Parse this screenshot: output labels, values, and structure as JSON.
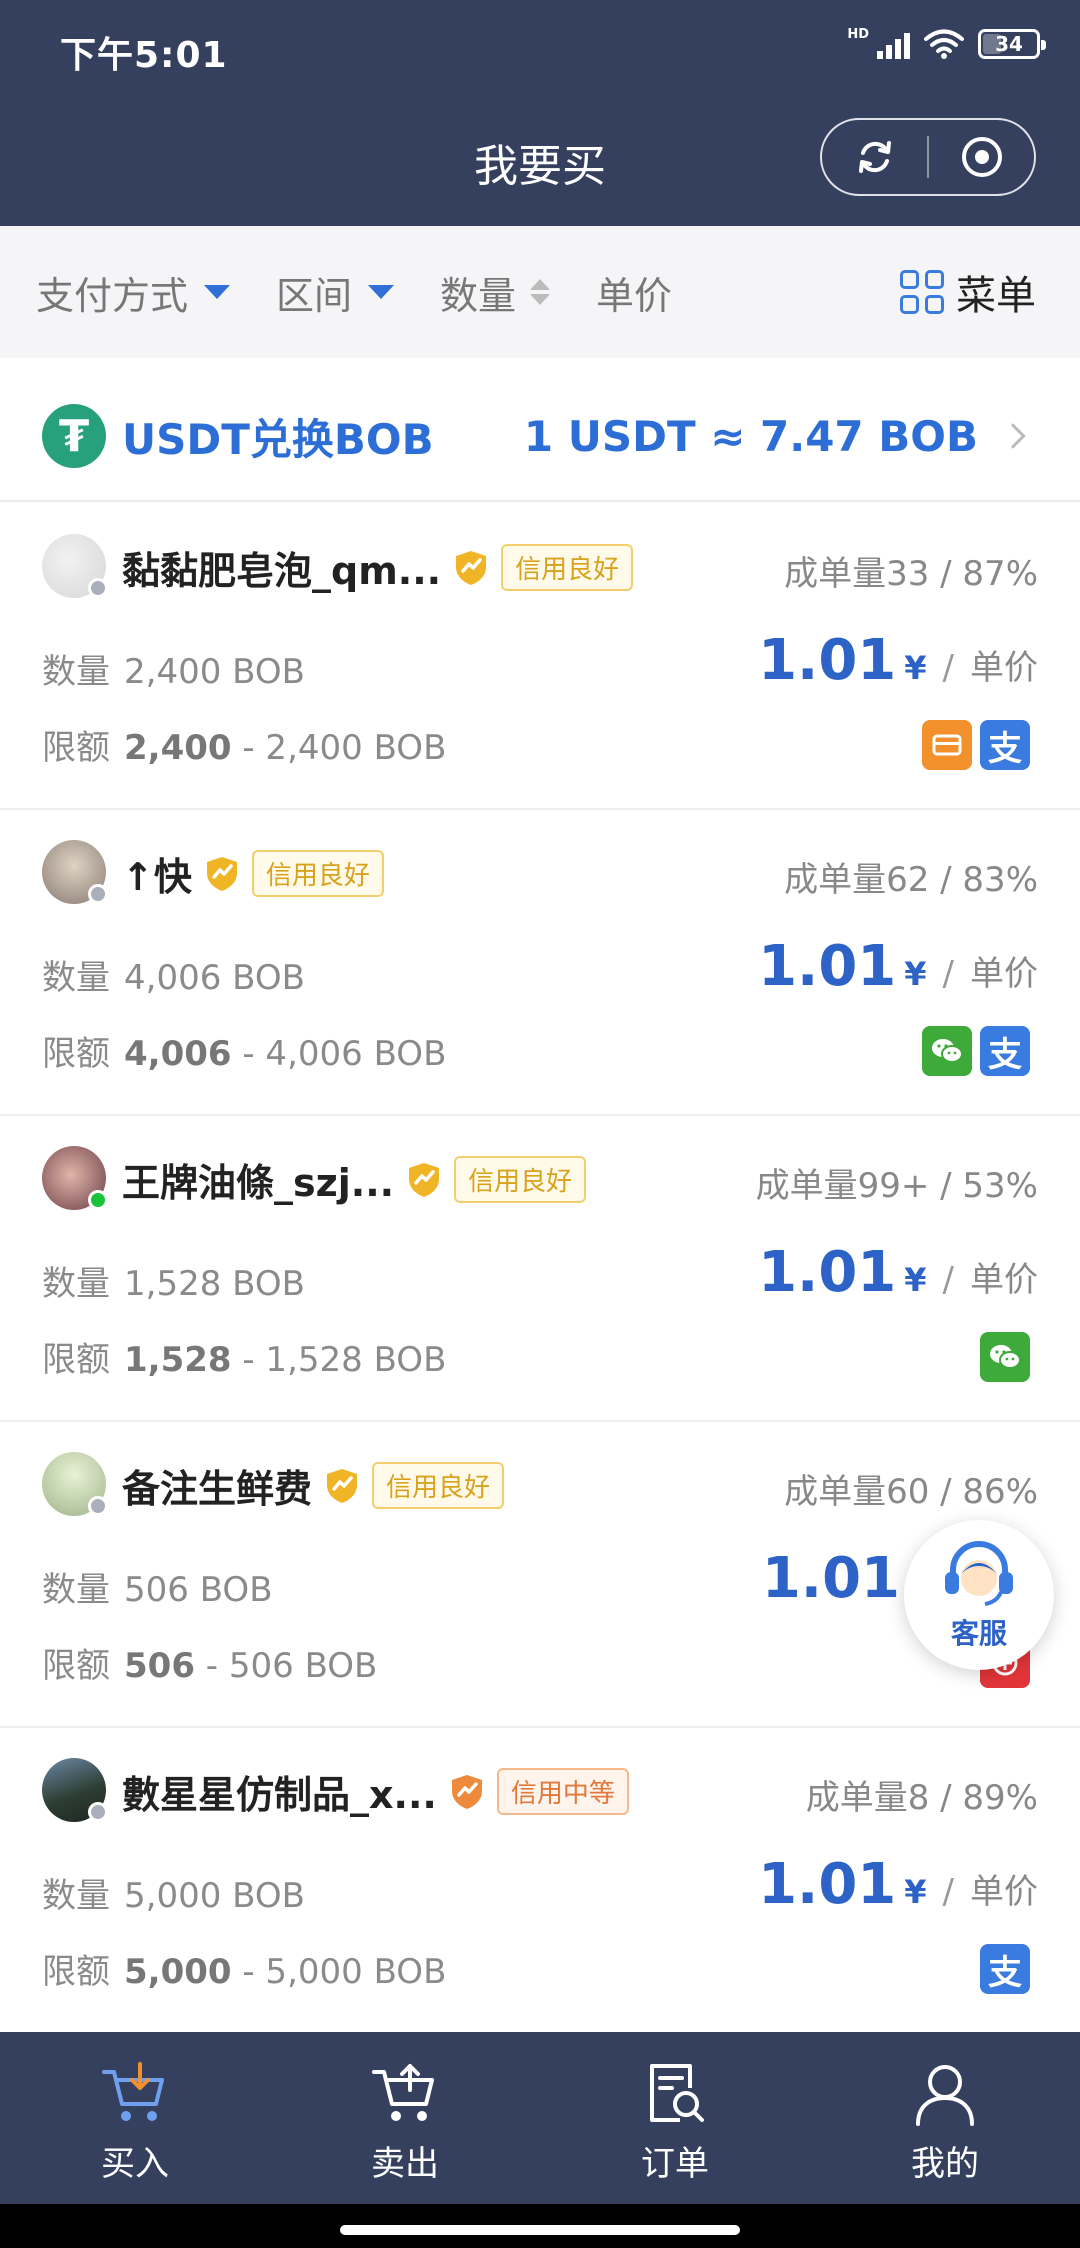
{
  "status_bar": {
    "time": "下午5:01",
    "network": "HD",
    "battery": "34"
  },
  "header": {
    "title": "我要买"
  },
  "filters": {
    "payment": "支付方式",
    "range": "区间",
    "quantity": "数量",
    "price": "单价",
    "menu": "菜单"
  },
  "exchange": {
    "title": "USDT兑换BOB",
    "rate": "1 USDT ≈ 7.47 BOB"
  },
  "listings": [
    {
      "name": "黏黏肥皂泡_qm...",
      "credit": "信用良好",
      "stats": "成单量33 / 87%",
      "qty_label": "数量",
      "qty": "2,400  BOB",
      "limit_label": "限额",
      "limit_min": "2,400",
      "limit_rest": " - 2,400  BOB",
      "price": "1.01",
      "currency": "¥",
      "unit": "单价",
      "payments": [
        "bank-card",
        "alipay"
      ]
    },
    {
      "name": "↑快",
      "credit": "信用良好",
      "stats": "成单量62 / 83%",
      "qty_label": "数量",
      "qty": "4,006  BOB",
      "limit_label": "限额",
      "limit_min": "4,006",
      "limit_rest": " - 4,006  BOB",
      "price": "1.01",
      "currency": "¥",
      "unit": "单价",
      "payments": [
        "wechat",
        "alipay"
      ]
    },
    {
      "name": "王牌油條_szj...",
      "credit": "信用良好",
      "stats": "成单量99+ / 53%",
      "qty_label": "数量",
      "qty": "1,528  BOB",
      "limit_label": "限额",
      "limit_min": "1,528",
      "limit_rest": " - 1,528  BOB",
      "price": "1.01",
      "currency": "¥",
      "unit": "单价",
      "payments": [
        "wechat"
      ]
    },
    {
      "name": "备注生鲜费",
      "credit": "信用良好",
      "stats": "成单量60 / 86%",
      "qty_label": "数量",
      "qty": "506  BOB",
      "limit_label": "限额",
      "limit_min": "506",
      "limit_rest": " - 506  BOB",
      "price": "1.01",
      "currency": "",
      "unit": "",
      "payments": [
        "unionpay"
      ]
    },
    {
      "name": "數星星仿制品_x...",
      "credit": "信用中等",
      "stats": "成单量8 / 89%",
      "qty_label": "数量",
      "qty": "5,000  BOB",
      "limit_label": "限额",
      "limit_min": "5,000",
      "limit_rest": " - 5,000  BOB",
      "price": "1.01",
      "currency": "¥",
      "unit": "单价",
      "payments": [
        "alipay"
      ]
    }
  ],
  "customer_service": {
    "label": "客服"
  },
  "tabs": [
    {
      "label": "买入",
      "icon": "cart-down-icon"
    },
    {
      "label": "卖出",
      "icon": "cart-up-icon"
    },
    {
      "label": "订单",
      "icon": "order-search-icon"
    },
    {
      "label": "我的",
      "icon": "user-icon"
    }
  ],
  "colors": {
    "header_bg": "#34405e",
    "accent_blue": "#2d63c6",
    "tether_green": "#26a17b",
    "credit_good": "#d9a21b",
    "credit_mid": "#e0793c"
  }
}
